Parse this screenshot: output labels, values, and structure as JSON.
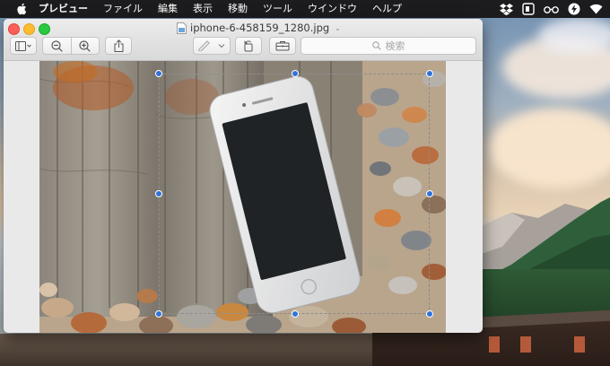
{
  "menubar": {
    "apple_icon": "apple-icon",
    "items": [
      "プレビュー",
      "ファイル",
      "編集",
      "表示",
      "移動",
      "ツール",
      "ウインドウ",
      "ヘルプ"
    ],
    "tray_icons": [
      "dropbox-icon",
      "evernote-icon",
      "glasses-icon",
      "lightning-icon",
      "wifi-icon"
    ]
  },
  "window": {
    "title": "iphone-6-458159_1280.jpg",
    "file_icon": "jpeg-file-icon",
    "toolbar": {
      "sidebar_icon": "sidebar-toggle-icon",
      "zoom_out_icon": "zoom-out-icon",
      "zoom_in_icon": "zoom-in-icon",
      "share_icon": "share-icon",
      "markup_icon": "pen-markup-icon",
      "rotate_icon": "rotate-icon",
      "toolbox_icon": "toolbox-icon",
      "search_placeholder": "検索"
    }
  },
  "colors": {
    "selection_handle": "#2f72d9",
    "close": "#fc5f57",
    "minimize": "#fdbc2e",
    "maximize": "#28c840"
  }
}
